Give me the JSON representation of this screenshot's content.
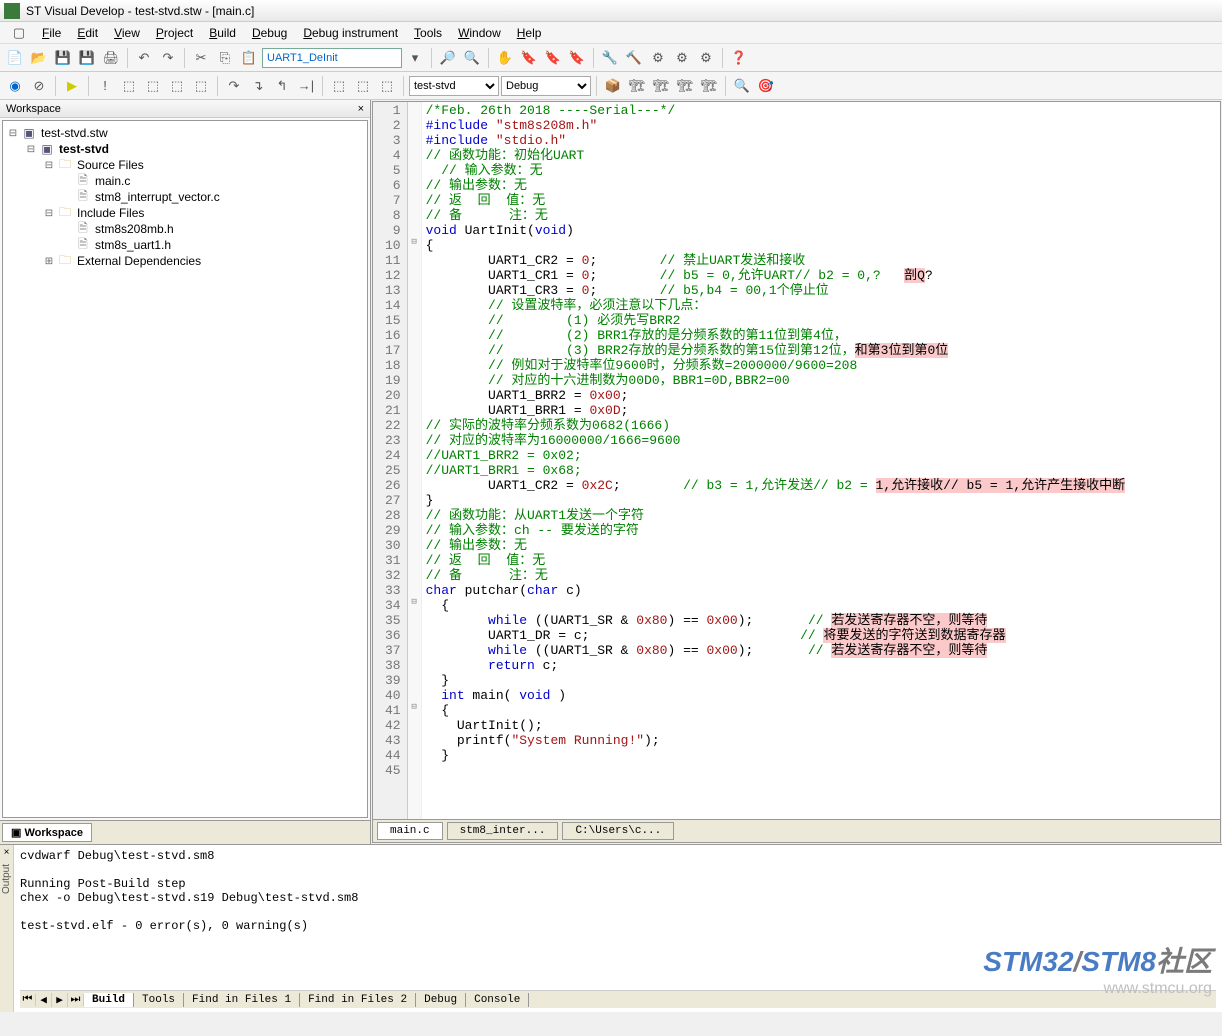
{
  "title": "ST Visual Develop - test-stvd.stw - [main.c]",
  "menu": [
    "File",
    "Edit",
    "View",
    "Project",
    "Build",
    "Debug",
    "Debug instrument",
    "Tools",
    "Window",
    "Help"
  ],
  "search_box": "UART1_DeInit",
  "config_select1": "test-stvd",
  "config_select2": "Debug",
  "workspace_title": "Workspace",
  "workspace_tab": "Workspace",
  "tree": {
    "root": "test-stvd.stw",
    "project": "test-stvd",
    "folders": [
      {
        "name": "Source Files",
        "files": [
          "main.c",
          "stm8_interrupt_vector.c"
        ]
      },
      {
        "name": "Include Files",
        "files": [
          "stm8s208mb.h",
          "stm8s_uart1.h"
        ]
      },
      {
        "name": "External Dependencies",
        "files": []
      }
    ]
  },
  "code": [
    {
      "n": 1,
      "html": "<span class='c-comment'>/*Feb. 26th 2018 ----Serial---*/</span>"
    },
    {
      "n": 2,
      "html": "<span class='c-keyword'>#include</span> <span class='c-string'>\"stm8s208m.h\"</span>"
    },
    {
      "n": 3,
      "html": "<span class='c-keyword'>#include</span> <span class='c-string'>\"stdio.h\"</span>"
    },
    {
      "n": 4,
      "html": "<span class='c-comment'>// 函数功能：初始化UART</span>"
    },
    {
      "n": 5,
      "html": "  <span class='c-comment'>// 输入参数：无</span>"
    },
    {
      "n": 6,
      "html": "<span class='c-comment'>// 输出参数：无</span>"
    },
    {
      "n": 7,
      "html": "<span class='c-comment'>// 返  回  值：无</span>"
    },
    {
      "n": 8,
      "html": "<span class='c-comment'>// 备      注：无</span>"
    },
    {
      "n": 9,
      "html": "<span class='c-keyword'>void</span> UartInit(<span class='c-keyword'>void</span>)"
    },
    {
      "n": 10,
      "fold": "⊟",
      "html": "{"
    },
    {
      "n": 11,
      "html": "        UART1_CR2 = <span class='c-number'>0</span>;        <span class='c-comment'>// 禁止UART发送和接收</span>"
    },
    {
      "n": 12,
      "html": "        UART1_CR1 = <span class='c-number'>0</span>;        <span class='c-comment'>// b5 = 0,允许UART// b2 = 0,?</span>   <span class='c-highlight'>剖Q</span>?"
    },
    {
      "n": 13,
      "html": "        UART1_CR3 = <span class='c-number'>0</span>;        <span class='c-comment'>// b5,b4 = 00,1个停止位</span>"
    },
    {
      "n": 14,
      "html": "        <span class='c-comment'>// 设置波特率，必须注意以下几点：</span>"
    },
    {
      "n": 15,
      "html": "        <span class='c-comment'>//        (1) 必须先写BRR2</span>"
    },
    {
      "n": 16,
      "html": "        <span class='c-comment'>//        (2) BRR1存放的是分频系数的第11位到第4位，</span>"
    },
    {
      "n": 17,
      "html": "        <span class='c-comment'>//        (3) BRR2存放的是分频系数的第15位到第12位，</span><span class='c-highlight'>和第3位到第0位</span>"
    },
    {
      "n": 18,
      "html": "        <span class='c-comment'>// 例如对于波特率位9600时，分频系数=2000000/9600=208</span>"
    },
    {
      "n": 19,
      "html": "        <span class='c-comment'>// 对应的十六进制数为00D0，BBR1=0D,BBR2=00</span>"
    },
    {
      "n": 20,
      "html": "        UART1_BRR2 = <span class='c-number'>0x00</span>;"
    },
    {
      "n": 21,
      "html": "        UART1_BRR1 = <span class='c-number'>0x0D</span>;"
    },
    {
      "n": 22,
      "html": "<span class='c-comment'>// 实际的波特率分频系数为0682(1666)</span>"
    },
    {
      "n": 23,
      "html": "<span class='c-comment'>// 对应的波特率为16000000/1666=9600</span>"
    },
    {
      "n": 24,
      "html": "<span class='c-comment'>//UART1_BRR2 = 0x02;</span>"
    },
    {
      "n": 25,
      "html": "<span class='c-comment'>//UART1_BRR1 = 0x68;</span>"
    },
    {
      "n": 26,
      "html": "        UART1_CR2 = <span class='c-number'>0x2C</span>;        <span class='c-comment'>// b3 = 1,允许发送// b2 =</span> <span class='c-highlight'>1,允许接收// b5 = 1,允许产生接收中断</span>"
    },
    {
      "n": 27,
      "html": "}"
    },
    {
      "n": 28,
      "html": "<span class='c-comment'>// 函数功能：从UART1发送一个字符</span>"
    },
    {
      "n": 29,
      "html": "<span class='c-comment'>// 输入参数：ch -- 要发送的字符</span>"
    },
    {
      "n": 30,
      "html": "<span class='c-comment'>// 输出参数：无</span>"
    },
    {
      "n": 31,
      "html": "<span class='c-comment'>// 返  回  值：无</span>"
    },
    {
      "n": 32,
      "html": "<span class='c-comment'>// 备      注：无</span>"
    },
    {
      "n": 33,
      "html": "<span class='c-keyword'>char</span> putchar(<span class='c-keyword'>char</span> c)"
    },
    {
      "n": 34,
      "fold": "⊟",
      "html": "  {"
    },
    {
      "n": 35,
      "html": "        <span class='c-keyword'>while</span> ((UART1_SR &amp; <span class='c-number'>0x80</span>) == <span class='c-number'>0x00</span>);       <span class='c-comment'>// </span><span class='c-highlight'>若发送寄存器不空，则等待</span>"
    },
    {
      "n": 36,
      "html": "        UART1_DR = c;                           <span class='c-comment'>// </span><span class='c-highlight'>将要发送的字符送到数据寄存器</span>"
    },
    {
      "n": 37,
      "html": "        <span class='c-keyword'>while</span> ((UART1_SR &amp; <span class='c-number'>0x80</span>) == <span class='c-number'>0x00</span>);       <span class='c-comment'>// </span><span class='c-highlight'>若发送寄存器不空，则等待</span>"
    },
    {
      "n": 38,
      "html": "        <span class='c-keyword'>return</span> c;"
    },
    {
      "n": 39,
      "html": "  }"
    },
    {
      "n": 40,
      "html": "  <span class='c-keyword'>int</span> main( <span class='c-keyword'>void</span> )"
    },
    {
      "n": 41,
      "fold": "⊟",
      "html": "  {"
    },
    {
      "n": 42,
      "html": "    UartInit();"
    },
    {
      "n": 43,
      "html": "    printf(<span class='c-string'>\"System Running!\"</span>);"
    },
    {
      "n": 44,
      "html": "  }"
    },
    {
      "n": 45,
      "html": ""
    }
  ],
  "editor_tabs": [
    "main.c",
    "stm8_inter...",
    "C:\\Users\\c..."
  ],
  "output_text": "cvdwarf Debug\\test-stvd.sm8\n\nRunning Post-Build step\nchex -o Debug\\test-stvd.s19 Debug\\test-stvd.sm8\n\ntest-stvd.elf - 0 error(s), 0 warning(s)",
  "output_tabs": [
    "Build",
    "Tools",
    "Find in Files 1",
    "Find in Files 2",
    "Debug",
    "Console"
  ],
  "output_side_label": "Output",
  "watermark": {
    "a": "STM32",
    "b": "/",
    "c": "STM8",
    "d": "社区",
    "url": "www.stmcu.org"
  }
}
